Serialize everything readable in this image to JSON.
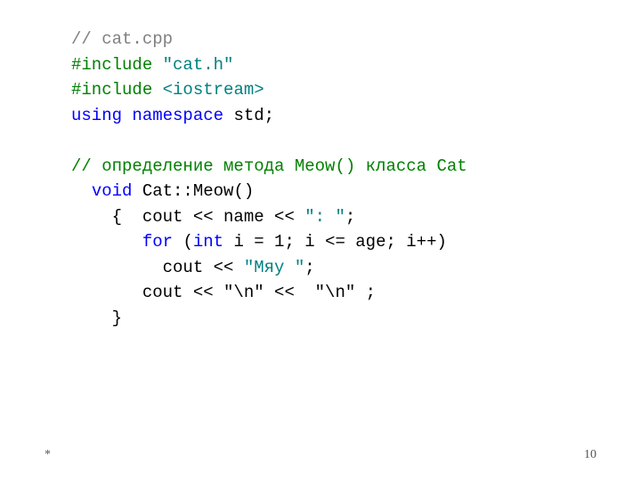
{
  "code": {
    "l1_comment": "// cat.cpp",
    "l2_include": "#include ",
    "l2_header": "\"cat.h\"",
    "l3_include": "#include ",
    "l3_header": "<iostream>",
    "l4_using": "using ",
    "l4_namespace": "namespace ",
    "l4_std": "std;",
    "l5_blank": " ",
    "l6_comment": "// определение метода Meow() класса Cat",
    "l7_indent": "  ",
    "l7_void": "void ",
    "l7_rest": "Cat::Meow()",
    "l8_indent": "    {  cout << name << ",
    "l8_str": "\": \"",
    "l8_semi": ";",
    "l9_indent": "       ",
    "l9_for": "for ",
    "l9_open": "(",
    "l9_int": "int ",
    "l9_rest": "i = 1; i <= age; i++)",
    "l10_indent": "         cout << ",
    "l10_str": "\"Мяу \"",
    "l10_semi": ";",
    "l11_text": "       cout << \"\\n\" <<  \"\\n\" ;",
    "l12_text": "    }"
  },
  "footer": {
    "left": "*",
    "right": "10"
  }
}
